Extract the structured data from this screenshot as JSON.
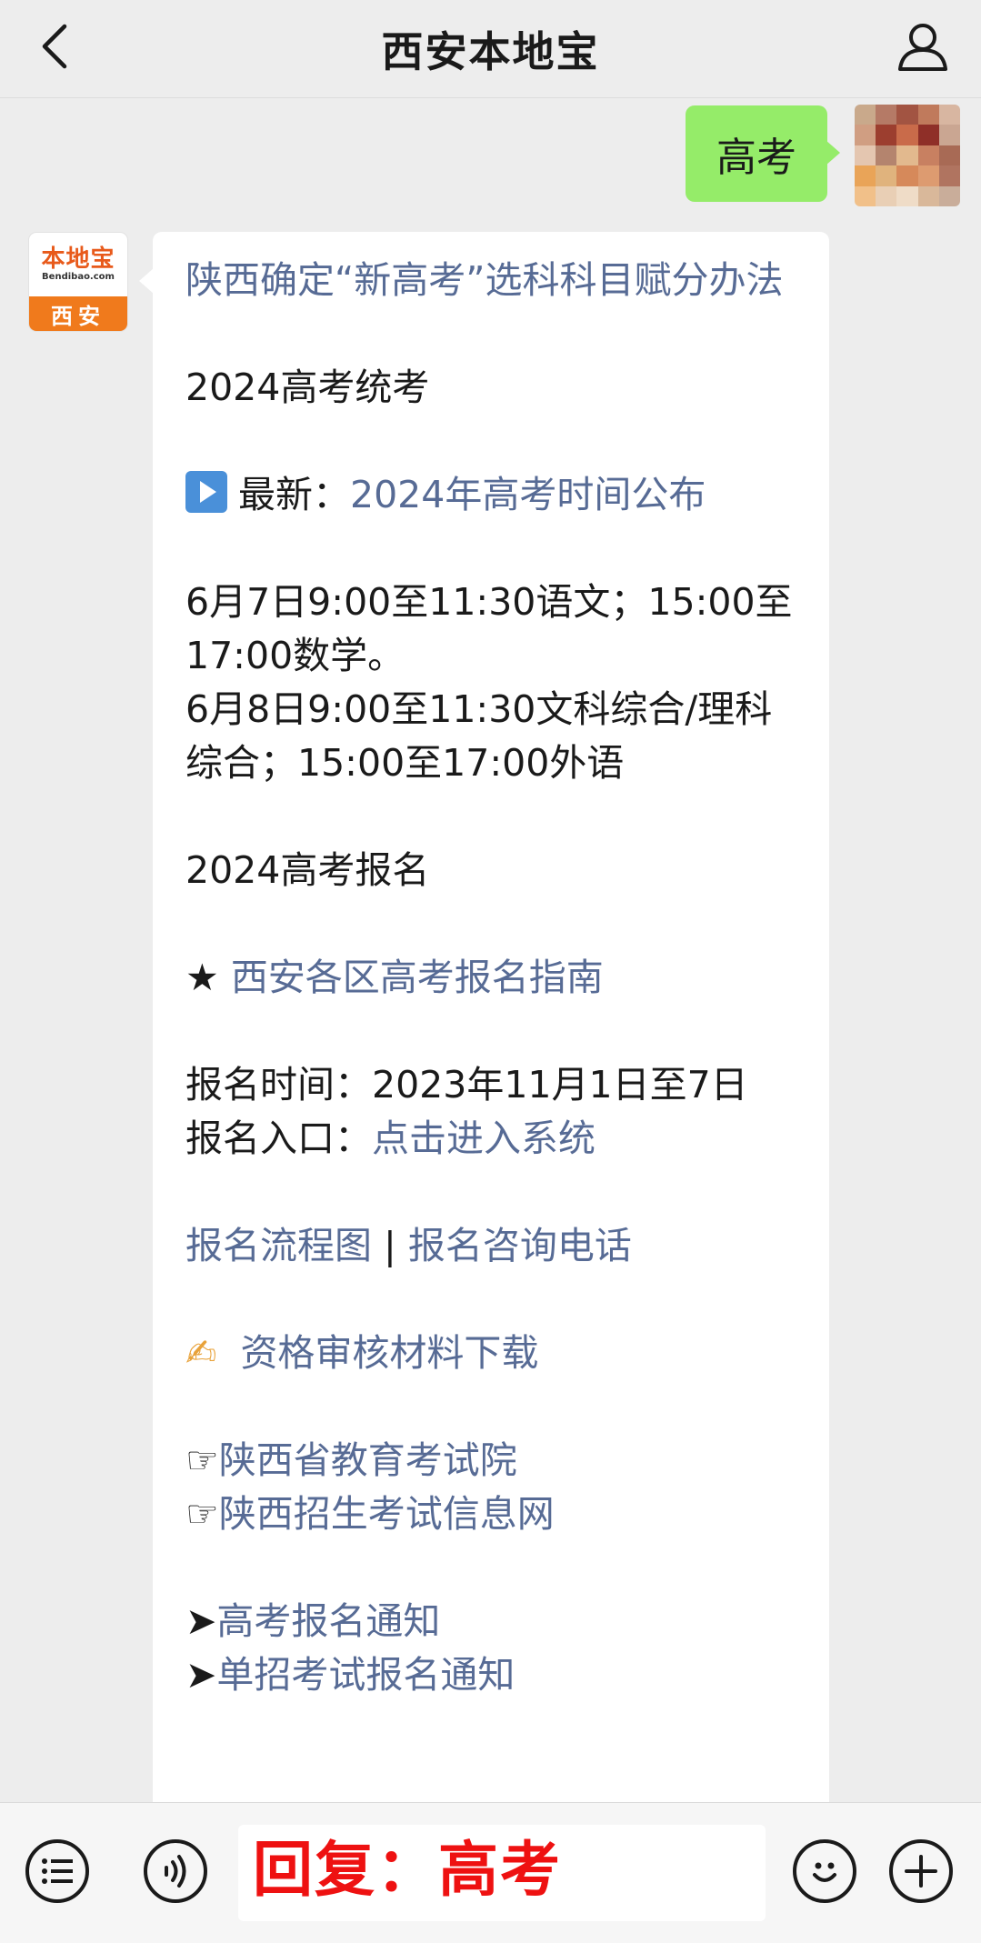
{
  "header": {
    "title": "西安本地宝"
  },
  "outgoing": {
    "text": "高考"
  },
  "bot": {
    "logo_text": "本地宝",
    "logo_sub": "Bendibao.com",
    "logo_city": "西安"
  },
  "message": {
    "title_link": "陕西确定“新高考”选科科目赋分办法",
    "section1": "2024高考统考",
    "latest_label": "最新：",
    "latest_link": "2024年高考时间公布",
    "schedule1": "6月7日9:00至11:30语文；15:00至17:00数学。",
    "schedule2": "6月8日9:00至11:30文科综合/理科综合；15:00至17:00外语",
    "section2": "2024高考报名",
    "star": "★",
    "guide_link": "西安各区高考报名指南",
    "reg_time": "报名时间：2023年11月1日至7日",
    "reg_entry_label": "报名入口：",
    "reg_entry_link": "点击进入系统",
    "flow_link": "报名流程图",
    "separator": "|",
    "phone_link": "报名咨询电话",
    "writing_emoji": "✍",
    "materials_link": "资格审核材料下载",
    "pointer": "☞",
    "edu_link": "陕西省教育考试院",
    "admission_link": "陕西招生考试信息网",
    "arrow": "➤",
    "notice_link": "高考报名通知",
    "single_link": "单招考试报名通知"
  },
  "input": {
    "text": "回复：高考"
  },
  "colors": {
    "link": "#576b95",
    "outgoing_bubble": "#95ec69",
    "background": "#ededed",
    "input_text": "#ee1111"
  },
  "icons": [
    "chevron-left-icon",
    "user-icon",
    "play-icon",
    "list-icon",
    "voice-icon",
    "emoji-icon",
    "plus-icon"
  ]
}
